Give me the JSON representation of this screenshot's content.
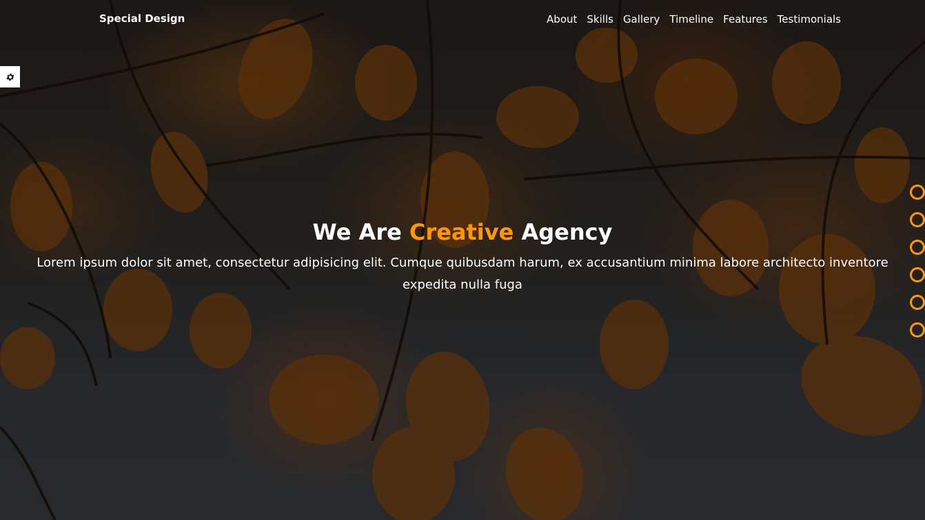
{
  "header": {
    "logo": "Special Design",
    "nav": [
      "About",
      "Skills",
      "Gallery",
      "Timeline",
      "Features",
      "Testimonials"
    ]
  },
  "settings": {
    "icon": "gear-icon"
  },
  "hero": {
    "title_before": "We Are ",
    "title_accent": "Creative",
    "title_after": " Agency",
    "description": "Lorem ipsum dolor sit amet, consectetur adipisicing elit. Cumque quibusdam harum, ex accusantium minima labore architecto inventore expedita nulla fuga"
  },
  "nav_bullets_count": 6,
  "colors": {
    "accent": "#ff9800",
    "text": "#ffffff"
  }
}
